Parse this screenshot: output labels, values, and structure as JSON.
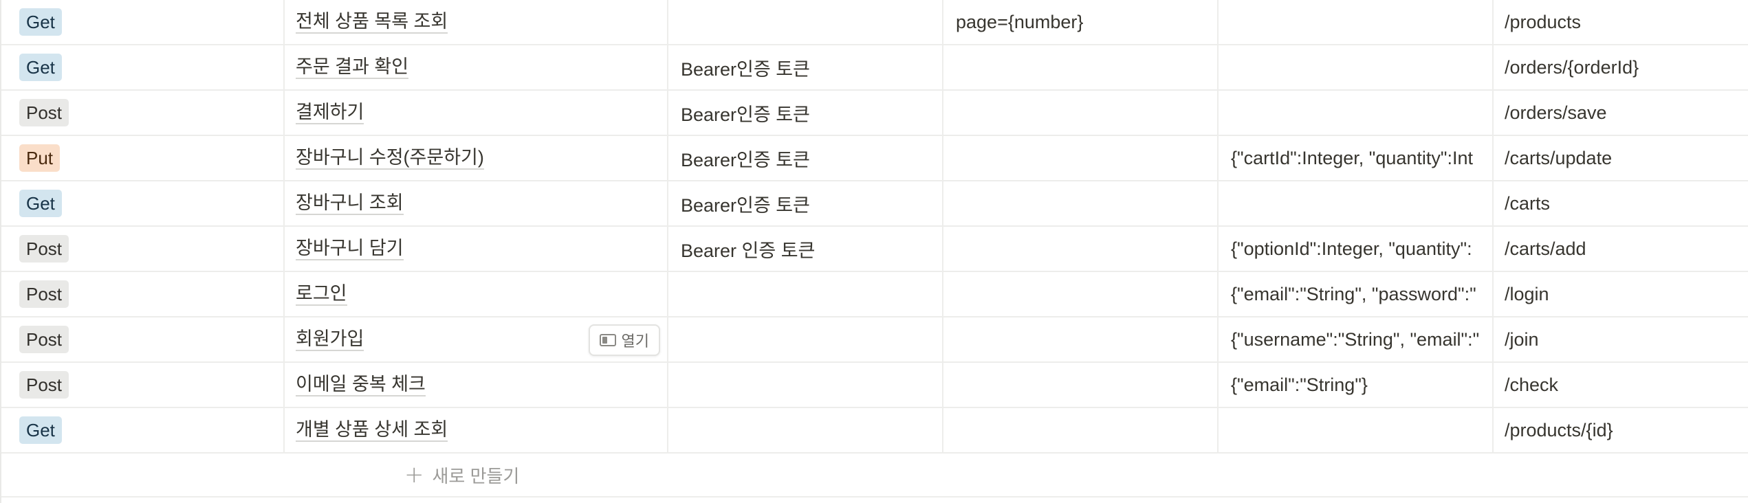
{
  "rows": [
    {
      "method": "Get",
      "method_color": "#d3e5ef",
      "title": "전체 상품 목록 조회",
      "auth": "",
      "param": "page={number}",
      "body": "",
      "endpoint": "/products"
    },
    {
      "method": "Get",
      "method_color": "#d3e5ef",
      "title": "주문 결과 확인",
      "auth": "Bearer인증 토큰",
      "param": "",
      "body": "",
      "endpoint": "/orders/{orderId}"
    },
    {
      "method": "Post",
      "method_color": "#e9e9e7",
      "title": "결제하기",
      "auth": "Bearer인증 토큰",
      "param": "",
      "body": "",
      "endpoint": "/orders/save"
    },
    {
      "method": "Put",
      "method_color": "#fadec9",
      "title": "장바구니 수정(주문하기)",
      "auth": "Bearer인증 토큰",
      "param": "",
      "body": "{\"cartId\":Integer, \"quantity\":Int",
      "endpoint": "/carts/update"
    },
    {
      "method": "Get",
      "method_color": "#d3e5ef",
      "title": "장바구니 조회",
      "auth": "Bearer인증 토큰",
      "param": "",
      "body": "",
      "endpoint": "/carts"
    },
    {
      "method": "Post",
      "method_color": "#e9e9e7",
      "title": "장바구니 담기",
      "auth": "Bearer 인증 토큰",
      "param": "",
      "body": "{\"optionId\":Integer, \"quantity\":",
      "endpoint": "/carts/add"
    },
    {
      "method": "Post",
      "method_color": "#e9e9e7",
      "title": "로그인",
      "auth": "",
      "param": "",
      "body": "{\"email\":\"String\", \"password\":\"",
      "endpoint": "/login"
    },
    {
      "method": "Post",
      "method_color": "#e9e9e7",
      "title": "회원가입",
      "auth": "",
      "param": "",
      "body": "{\"username\":\"String\", \"email\":\"",
      "endpoint": "/join"
    },
    {
      "method": "Post",
      "method_color": "#e9e9e7",
      "title": "이메일 중복 체크",
      "auth": "",
      "param": "",
      "body": "{\"email\":\"String\"}",
      "endpoint": "/check"
    },
    {
      "method": "Get",
      "method_color": "#d3e5ef",
      "title": "개별 상품 상세 조회",
      "auth": "",
      "param": "",
      "body": "",
      "endpoint": "/products/{id}"
    }
  ],
  "open_button_label": "열기",
  "open_button_row": 7,
  "new_row_label": "새로 만들기",
  "plus_glyph": "+"
}
